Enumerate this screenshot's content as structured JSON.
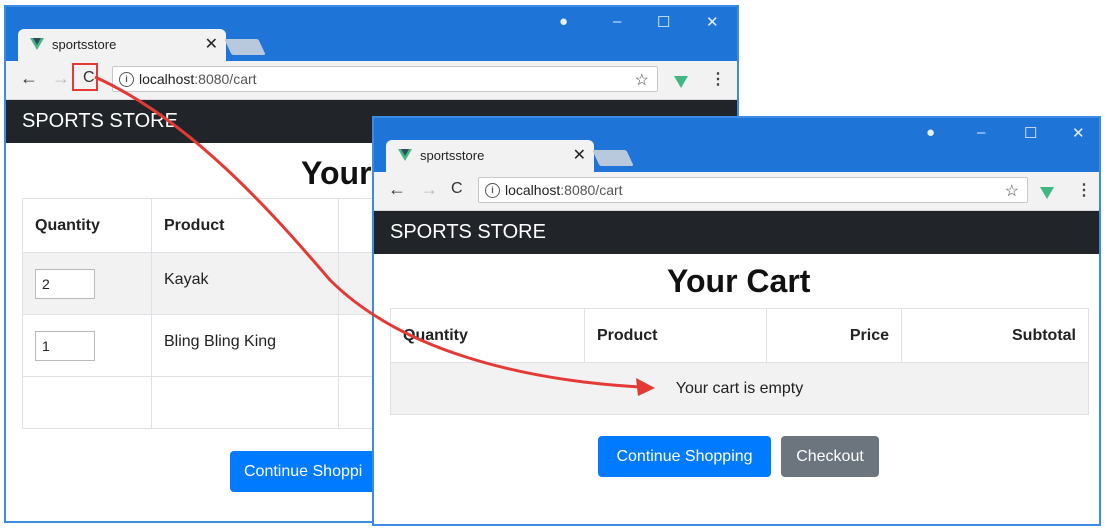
{
  "tab_title": "sportsstore",
  "url_host": "localhost",
  "url_path": ":8080/cart",
  "brand": "SPORTS STORE",
  "heading": "Your Cart",
  "heading_partial": "Your",
  "columns": {
    "quantity": "Quantity",
    "product": "Product",
    "price": "Price",
    "subtotal": "Subtotal"
  },
  "before_items": [
    {
      "quantity": "2",
      "product": "Kayak"
    },
    {
      "quantity": "1",
      "product": "Bling Bling King"
    }
  ],
  "empty_message": "Your cart is empty",
  "continue_label": "Continue Shopping",
  "continue_label_partial": "Continue Shoppi",
  "checkout_label": "Checkout",
  "icons": {
    "back": "←",
    "forward": "→",
    "reload": "C",
    "info": "i",
    "star": "☆",
    "menu": "⋮",
    "close": "✕",
    "minimize": "–",
    "maximize": "☐",
    "profile": "●"
  },
  "colors": {
    "titlebar": "#1f74d8",
    "navbar": "#212529",
    "primary": "#007bff",
    "secondary": "#6c757d",
    "arrow": "#e53935"
  }
}
